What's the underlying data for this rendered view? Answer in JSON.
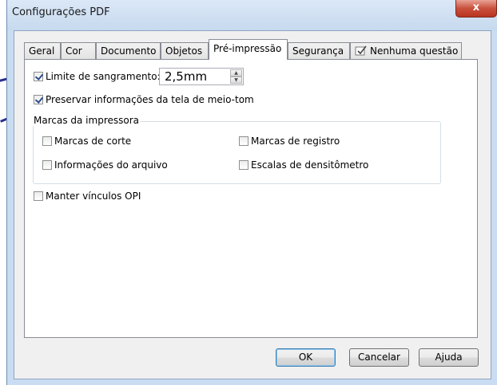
{
  "window": {
    "title": "Configurações PDF",
    "close_label": "x"
  },
  "tabs": [
    {
      "label": "Geral"
    },
    {
      "label": "Cor"
    },
    {
      "label": "Documento"
    },
    {
      "label": "Objetos"
    },
    {
      "label": "Pré-impressão"
    },
    {
      "label": "Segurança"
    },
    {
      "label": "Nenhuma questão"
    }
  ],
  "active_tab": "Pré-impressão",
  "prepress": {
    "bleed_limit": {
      "label": "Limite de sangramento:",
      "checked": true,
      "value": "2,5mm"
    },
    "preserve_halftone": {
      "label": "Preservar informações da tela de meio-tom",
      "checked": true
    },
    "printer_marks": {
      "group_label": "Marcas da impressora",
      "crop_marks": {
        "label": "Marcas de corte",
        "checked": false
      },
      "registration_marks": {
        "label": "Marcas de registro",
        "checked": false
      },
      "file_info": {
        "label": "Informações do arquivo",
        "checked": false
      },
      "densitometer_scales": {
        "label": "Escalas de densitômetro",
        "checked": false
      }
    },
    "keep_opi": {
      "label": "Manter vínculos OPI",
      "checked": false
    }
  },
  "buttons": {
    "ok": "OK",
    "cancel": "Cancelar",
    "help": "Ajuda"
  },
  "colors": {
    "accent_arrow": "#2a2f8f",
    "window_frame": "#c9dcf1"
  }
}
